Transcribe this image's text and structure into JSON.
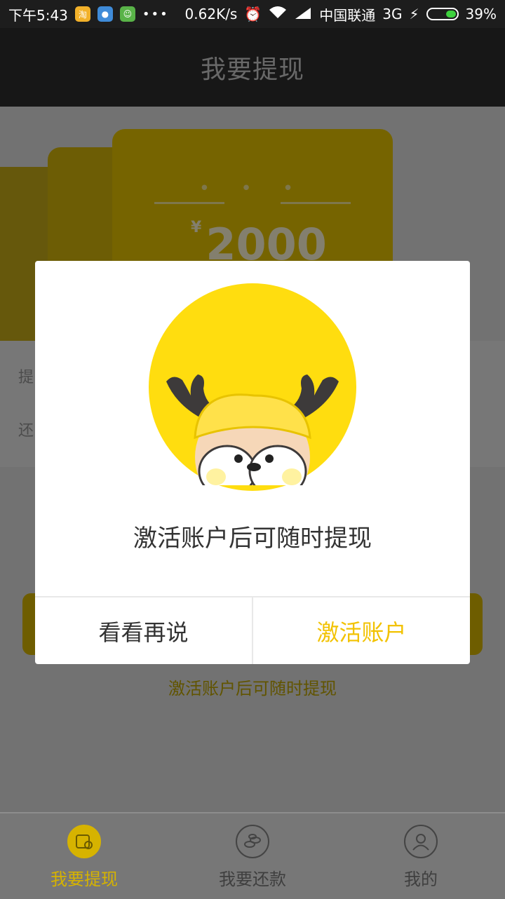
{
  "status_bar": {
    "time": "下午5:43",
    "more": "•••",
    "net_speed": "0.62K/s",
    "carrier": "中国联通",
    "network": "3G",
    "battery": "39%"
  },
  "header": {
    "title": "我要提现"
  },
  "background": {
    "amount_currency": "¥",
    "amount_value": "2000",
    "card_dots": "• • •",
    "row1_prefix": "提",
    "row2_prefix": "还",
    "cta_hint": "激活账户后可随时提现"
  },
  "dialog": {
    "message": "激活账户后可随时提现",
    "cancel_label": "看看再说",
    "confirm_label": "激活账户"
  },
  "bottom_nav": {
    "items": [
      {
        "label": "我要提现",
        "icon": "wallet-icon",
        "active": true
      },
      {
        "label": "我要还款",
        "icon": "coins-icon",
        "active": false
      },
      {
        "label": "我的",
        "icon": "user-icon",
        "active": false
      }
    ]
  },
  "colors": {
    "accent": "#f2c200",
    "overlay": "rgba(0,0,0,0.45)"
  }
}
